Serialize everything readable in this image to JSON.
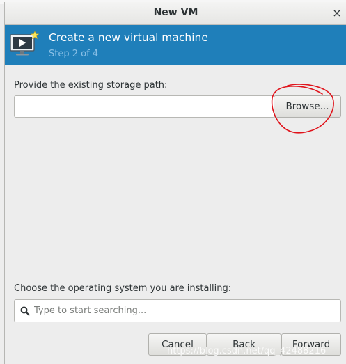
{
  "window": {
    "title": "New VM",
    "close_label": "×"
  },
  "banner": {
    "title": "Create a new virtual machine",
    "subtitle": "Step 2 of 4",
    "icon": "virtual-machine-icon",
    "color": "#1f7fba"
  },
  "storage": {
    "label": "Provide the existing storage path:",
    "path_value": "",
    "browse_label": "Browse..."
  },
  "os": {
    "label": "Choose the operating system you are installing:",
    "search_placeholder": "Type to start searching..."
  },
  "actions": {
    "cancel_label": "Cancel",
    "back_label": "Back",
    "forward_label": "Forward"
  },
  "annotation": {
    "color": "#e0131b",
    "target": "browse-button"
  },
  "watermark": "https://blog.csdn.net/qq_42488216"
}
